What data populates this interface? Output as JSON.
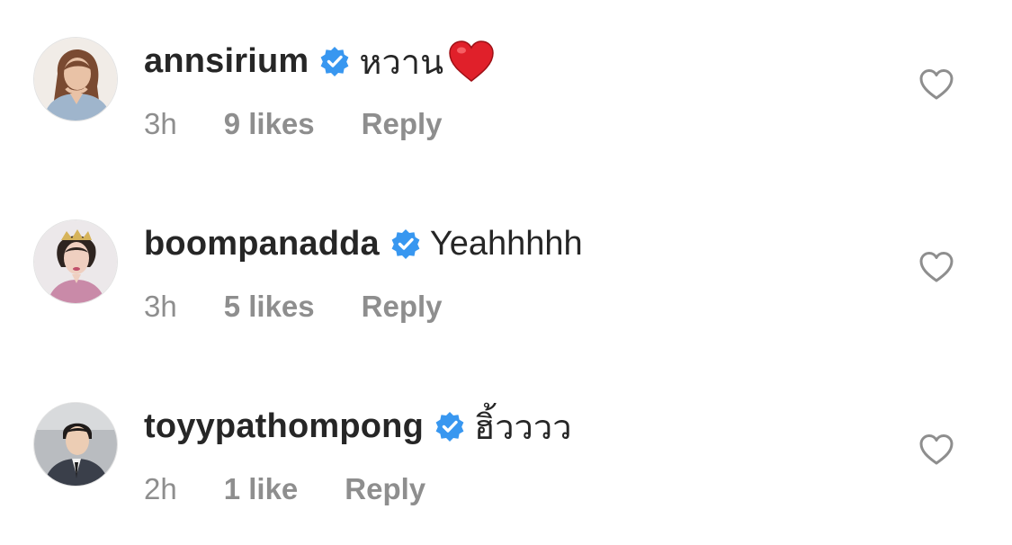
{
  "comments": [
    {
      "username": "annsirium",
      "text": "หวาน",
      "emoji": "heart-emoji",
      "time": "3h",
      "likes": "9 likes",
      "reply": "Reply"
    },
    {
      "username": "boompanadda",
      "text": "Yeahhhhh",
      "time": "3h",
      "likes": "5 likes",
      "reply": "Reply"
    },
    {
      "username": "toyypathompong",
      "text": "ฮิ้วววว",
      "time": "2h",
      "likes": "1 like",
      "reply": "Reply"
    }
  ],
  "colors": {
    "text": "#262626",
    "secondary": "#8e8e8e",
    "verified_badge": "#3897f0",
    "heart_emoji": "#e0202a",
    "like_icon": "#8e8e8e"
  },
  "icons": {
    "verified": "verified-badge-icon",
    "like": "heart-outline-icon"
  }
}
